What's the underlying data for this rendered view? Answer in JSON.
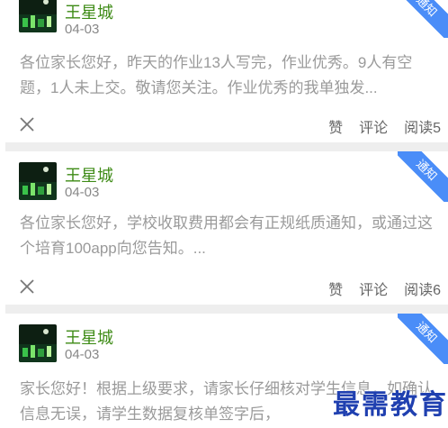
{
  "posts": [
    {
      "author": "王星城",
      "date": "04-03",
      "body": "各位家长您好，昨天的作业13人写完，作业优秀。9人有空题，1人未上交。敬请您关注。作业优秀的我单独发...",
      "ribbon": "通知",
      "like_label": "赞",
      "comment_label": "评论",
      "read_label": "阅读5"
    },
    {
      "author": "王星城",
      "date": "04-03",
      "body": "各位家长您好，学校收取费用都会有正规纸质通知，或通过这个培育100app向您告知。...",
      "ribbon": "通知",
      "like_label": "赞",
      "comment_label": "评论",
      "read_label": "阅读6"
    },
    {
      "author": "王星城",
      "date": "04-03",
      "body": "家长您好！根据上级要求，请家长仔细核对学生信息，如确认信息无误，请学生数据复核单签字后，",
      "ribbon": "通知"
    }
  ],
  "icons": {
    "close": "close-icon",
    "avatar": "avatar-image"
  },
  "colors": {
    "author": "#3e8b16",
    "ribbon": "#4a8df8",
    "body": "#9a9a9a",
    "watermark": "#2040b0"
  },
  "watermark": "最需教育"
}
